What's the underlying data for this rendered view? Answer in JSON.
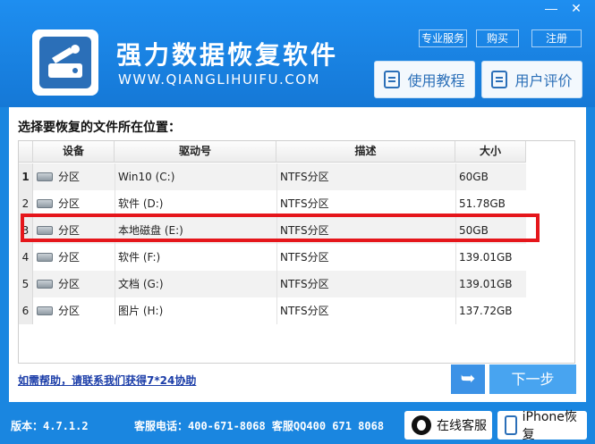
{
  "window": {
    "minimize": "—",
    "close": "✕"
  },
  "header": {
    "title": "强力数据恢复软件",
    "url": "WWW.QIANGLIHUIFU.COM",
    "links": [
      "专业服务",
      "购买",
      "注册"
    ],
    "tutorial_btn": "使用教程",
    "review_btn": "用户评价"
  },
  "panel": {
    "title": "选择要恢复的文件所在位置：",
    "columns": [
      "设备",
      "驱动号",
      "描述",
      "大小"
    ],
    "rows": [
      {
        "idx": "1",
        "device": "分区",
        "drive": "Win10 (C:)",
        "desc": "NTFS分区",
        "size": "60GB"
      },
      {
        "idx": "2",
        "device": "分区",
        "drive": "软件 (D:)",
        "desc": "NTFS分区",
        "size": "51.78GB"
      },
      {
        "idx": "3",
        "device": "分区",
        "drive": "本地磁盘 (E:)",
        "desc": "NTFS分区",
        "size": "50GB"
      },
      {
        "idx": "4",
        "device": "分区",
        "drive": "软件 (F:)",
        "desc": "NTFS分区",
        "size": "139.01GB"
      },
      {
        "idx": "5",
        "device": "分区",
        "drive": "文档 (G:)",
        "desc": "NTFS分区",
        "size": "139.01GB"
      },
      {
        "idx": "6",
        "device": "分区",
        "drive": "图片 (H:)",
        "desc": "NTFS分区",
        "size": "137.72GB"
      }
    ],
    "help_link": "如需帮助，请联系我们获得7*24协助",
    "back_icon": "➥",
    "next_btn": "下一步"
  },
  "footer": {
    "version": "版本：4.7.1.2",
    "contact": "客服电话：400-671-8068 客服QQ400 671 8068",
    "online_btn": "在线客服",
    "iphone_btn": "iPhone恢复"
  },
  "colors": {
    "accent": "#1a86e0",
    "highlight": "#e5161b"
  }
}
